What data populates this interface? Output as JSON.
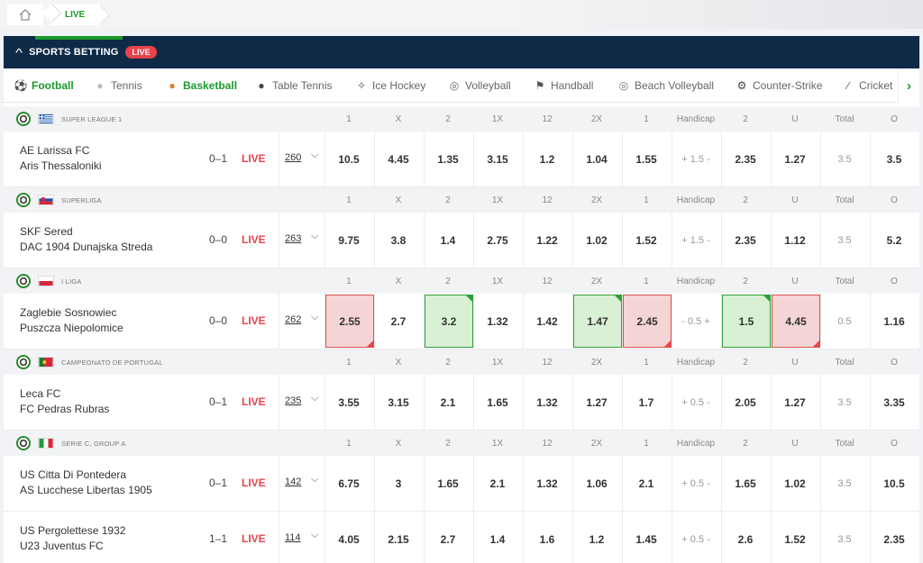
{
  "breadcrumb": {
    "live_label": "LIVE"
  },
  "header": {
    "title": "SPORTS BETTING",
    "live_badge": "LIVE"
  },
  "sports_tabs": [
    {
      "label": "Football",
      "icon": "football-icon",
      "highlight": true
    },
    {
      "label": "Tennis",
      "icon": "tennis-ball-icon",
      "highlight": false
    },
    {
      "label": "Basketball",
      "icon": "basketball-icon",
      "highlight": true
    },
    {
      "label": "Table Tennis",
      "icon": "table-tennis-icon",
      "highlight": false
    },
    {
      "label": "Ice Hockey",
      "icon": "ice-hockey-icon",
      "highlight": false
    },
    {
      "label": "Volleyball",
      "icon": "volleyball-icon",
      "highlight": false
    },
    {
      "label": "Handball",
      "icon": "handball-icon",
      "highlight": false
    },
    {
      "label": "Beach Volleyball",
      "icon": "beach-volleyball-icon",
      "highlight": false
    },
    {
      "label": "Counter-Strike",
      "icon": "counter-strike-icon",
      "highlight": false
    },
    {
      "label": "Cricket",
      "icon": "cricket-icon",
      "highlight": false
    }
  ],
  "column_headers": [
    "1",
    "X",
    "2",
    "1X",
    "12",
    "2X",
    "1",
    "Handicap",
    "2",
    "U",
    "Total",
    "O"
  ],
  "leagues": [
    {
      "name": "SUPER LEAGUE 1",
      "flag": "greece",
      "matches": [
        {
          "home": "AE Larissa FC",
          "away": "Aris Thessaloniki",
          "score": "0–1",
          "status": "LIVE",
          "markets": "260",
          "odds": [
            "10.5",
            "4.45",
            "1.35",
            "3.15",
            "1.2",
            "1.04",
            "1.55",
            "+ 1.5 -",
            "2.35",
            "1.27",
            "3.5",
            "3.5"
          ],
          "states": [
            "",
            "",
            "",
            "",
            "",
            "",
            "",
            "muted",
            "",
            "",
            "muted",
            ""
          ]
        }
      ]
    },
    {
      "name": "SUPERLIGA",
      "flag": "slovakia",
      "matches": [
        {
          "home": "SKF Sered",
          "away": "DAC 1904 Dunajska Streda",
          "score": "0–0",
          "status": "LIVE",
          "markets": "263",
          "odds": [
            "9.75",
            "3.8",
            "1.4",
            "2.75",
            "1.22",
            "1.02",
            "1.52",
            "+ 1.5 -",
            "2.35",
            "1.12",
            "3.5",
            "5.2"
          ],
          "states": [
            "",
            "",
            "",
            "",
            "",
            "",
            "",
            "muted",
            "",
            "",
            "muted",
            ""
          ]
        }
      ]
    },
    {
      "name": "I LIGA",
      "flag": "poland",
      "matches": [
        {
          "home": "Zaglebie Sosnowiec",
          "away": "Puszcza Niepolomice",
          "score": "0–0",
          "status": "LIVE",
          "markets": "262",
          "odds": [
            "2.55",
            "2.7",
            "3.2",
            "1.32",
            "1.42",
            "1.47",
            "2.45",
            "- 0.5 +",
            "1.5",
            "4.45",
            "0.5",
            "1.16"
          ],
          "states": [
            "red",
            "",
            "green",
            "",
            "",
            "green",
            "red",
            "muted",
            "green",
            "red",
            "muted",
            ""
          ]
        }
      ]
    },
    {
      "name": "CAMPEONATO DE PORTUGAL",
      "flag": "portugal",
      "matches": [
        {
          "home": "Leca FC",
          "away": "FC Pedras Rubras",
          "score": "0–1",
          "status": "LIVE",
          "markets": "235",
          "odds": [
            "3.55",
            "3.15",
            "2.1",
            "1.65",
            "1.32",
            "1.27",
            "1.7",
            "+ 0.5 -",
            "2.05",
            "1.27",
            "3.5",
            "3.35"
          ],
          "states": [
            "",
            "",
            "",
            "",
            "",
            "",
            "",
            "muted",
            "",
            "",
            "muted",
            ""
          ]
        }
      ]
    },
    {
      "name": "SERIE C, GROUP A",
      "flag": "italy",
      "matches": [
        {
          "home": "US Citta Di Pontedera",
          "away": "AS Lucchese Libertas 1905",
          "score": "0–1",
          "status": "LIVE",
          "markets": "142",
          "odds": [
            "6.75",
            "3",
            "1.65",
            "2.1",
            "1.32",
            "1.06",
            "2.1",
            "+ 0.5 -",
            "1.65",
            "1.02",
            "3.5",
            "10.5"
          ],
          "states": [
            "",
            "",
            "",
            "",
            "",
            "",
            "",
            "muted",
            "",
            "",
            "muted",
            ""
          ]
        },
        {
          "home": "US Pergolettese 1932",
          "away": "U23 Juventus FC",
          "score": "1–1",
          "status": "LIVE",
          "markets": "114",
          "odds": [
            "4.05",
            "2.15",
            "2.7",
            "1.4",
            "1.6",
            "1.2",
            "1.45",
            "+ 0.5 -",
            "2.6",
            "1.52",
            "3.5",
            "2.35"
          ],
          "states": [
            "",
            "",
            "",
            "",
            "",
            "",
            "",
            "muted",
            "",
            "",
            "muted",
            ""
          ]
        }
      ]
    }
  ],
  "colors": {
    "brand_green": "#1c9a2c",
    "header_navy": "#0e2a47",
    "live_red": "#e8434b"
  }
}
